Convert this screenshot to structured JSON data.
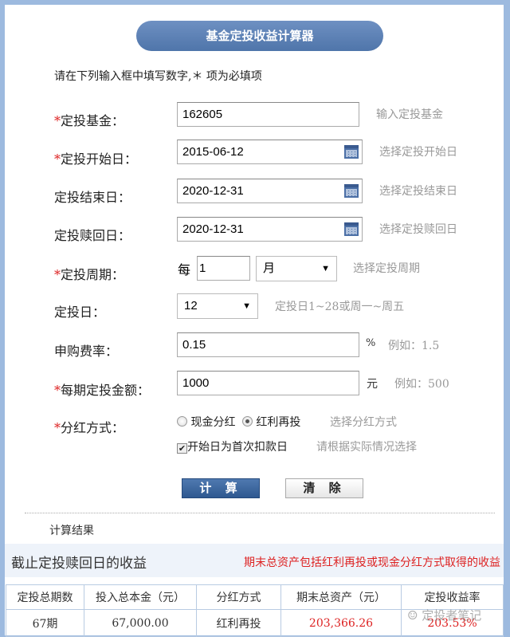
{
  "title": "基金定投收益计算器",
  "intro": "请在下列输入框中填写数字,＊ 项为必填项",
  "fields": {
    "fund": {
      "label": "定投基金：",
      "required": true,
      "value": "162605",
      "hint": "输入定投基金"
    },
    "start": {
      "label": "定投开始日：",
      "required": true,
      "value": "2015-06-12",
      "hint": "选择定投开始日"
    },
    "end": {
      "label": "定投结束日：",
      "required": false,
      "value": "2020-12-31",
      "hint": "选择定投结束日"
    },
    "redeem": {
      "label": "定投赎回日：",
      "required": false,
      "value": "2020-12-31",
      "hint": "选择定投赎回日"
    },
    "period": {
      "label": "定投周期：",
      "required": true,
      "prefix": "每",
      "value": "1",
      "unit": "月",
      "hint": "选择定投周期"
    },
    "day": {
      "label": "定投日：",
      "required": false,
      "value": "12",
      "hint": "定投日1~28或周一~周五"
    },
    "fee": {
      "label": "申购费率：",
      "required": false,
      "value": "0.15",
      "unit": "%",
      "hint": "例如：1.5"
    },
    "amount": {
      "label": "每期定投金额：",
      "required": true,
      "value": "1000",
      "unit": "元",
      "hint": "例如：500"
    },
    "dividend": {
      "label": "分红方式：",
      "required": true,
      "options": [
        "现金分红",
        "红利再投"
      ],
      "selected": 1,
      "hint": "选择分红方式"
    },
    "first_day": {
      "label": "开始日为首次扣款日",
      "checked": true,
      "hint": "请根据实际情况选择"
    }
  },
  "buttons": {
    "calc": "计 算",
    "clear": "清 除"
  },
  "result": {
    "heading": "计算结果",
    "subtitle": "截止定投赎回日的收益",
    "note": "期末总资产包括红利再投或现金分红方式取得的收益",
    "headers": [
      "定投总期数",
      "投入总本金（元）",
      "分红方式",
      "期末总资产（元）",
      "定投收益率"
    ],
    "row": [
      "67期",
      "67,000.00",
      "红利再投",
      "203,366.26",
      "203.53%"
    ]
  },
  "watermark": "定投者笔记",
  "colors": {
    "accent": "#4f75aa",
    "required": "#dd2222",
    "border": "#9dbadf"
  }
}
